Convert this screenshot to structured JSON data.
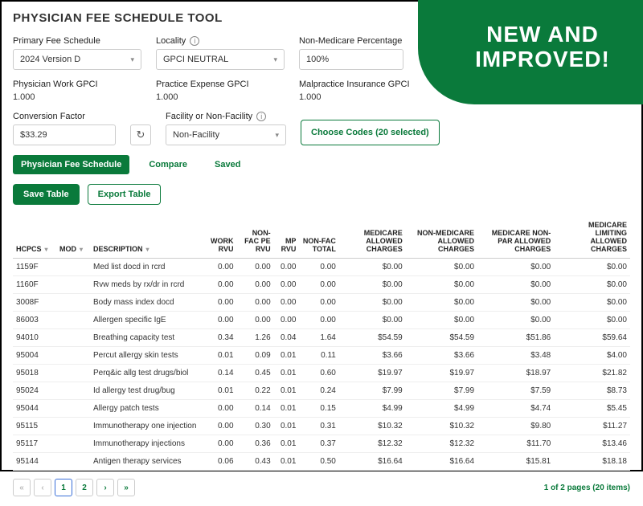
{
  "ribbon": {
    "line1": "NEW AND",
    "line2": "IMPROVED!"
  },
  "title": "PHYSICIAN FEE SCHEDULE TOOL",
  "filters": {
    "primary_label": "Primary Fee Schedule",
    "primary_value": "2024 Version D",
    "locality_label": "Locality",
    "locality_value": "GPCI NEUTRAL",
    "nonmed_label": "Non-Medicare Percentage",
    "nonmed_value": "100%"
  },
  "gpci": {
    "work_label": "Physician Work GPCI",
    "work_value": "1.000",
    "pe_label": "Practice Expense GPCI",
    "pe_value": "1.000",
    "mp_label": "Malpractice Insurance GPCI",
    "mp_value": "1.000"
  },
  "conv": {
    "label": "Conversion Factor",
    "value": "$33.29",
    "facility_label": "Facility or Non-Facility",
    "facility_value": "Non-Facility",
    "choose_codes": "Choose Codes (20 selected)"
  },
  "tabs": {
    "fee": "Physician Fee Schedule",
    "compare": "Compare",
    "saved": "Saved"
  },
  "buttons": {
    "save": "Save Table",
    "export": "Export Table"
  },
  "columns": {
    "hcpcs": "HCPCS",
    "mod": "MOD",
    "desc": "DESCRIPTION",
    "work": "WORK RVU",
    "nfpe": "NON-FAC PE RVU",
    "mp": "MP RVU",
    "nftot": "NON-FAC TOTAL",
    "med": "MEDICARE ALLOWED CHARGES",
    "nonmed": "NON-MEDICARE ALLOWED CHARGES",
    "nonpar": "MEDICARE NON-PAR ALLOWED CHARGES",
    "limit": "MEDICARE LIMITING ALLOWED CHARGES"
  },
  "rows": [
    {
      "hcpcs": "1159F",
      "mod": "",
      "desc": "Med list docd in rcrd",
      "work": "0.00",
      "nfpe": "0.00",
      "mp": "0.00",
      "nftot": "0.00",
      "med": "$0.00",
      "nonmed": "$0.00",
      "nonpar": "$0.00",
      "limit": "$0.00"
    },
    {
      "hcpcs": "1160F",
      "mod": "",
      "desc": "Rvw meds by rx/dr in rcrd",
      "work": "0.00",
      "nfpe": "0.00",
      "mp": "0.00",
      "nftot": "0.00",
      "med": "$0.00",
      "nonmed": "$0.00",
      "nonpar": "$0.00",
      "limit": "$0.00"
    },
    {
      "hcpcs": "3008F",
      "mod": "",
      "desc": "Body mass index docd",
      "work": "0.00",
      "nfpe": "0.00",
      "mp": "0.00",
      "nftot": "0.00",
      "med": "$0.00",
      "nonmed": "$0.00",
      "nonpar": "$0.00",
      "limit": "$0.00"
    },
    {
      "hcpcs": "86003",
      "mod": "",
      "desc": "Allergen specific IgE",
      "work": "0.00",
      "nfpe": "0.00",
      "mp": "0.00",
      "nftot": "0.00",
      "med": "$0.00",
      "nonmed": "$0.00",
      "nonpar": "$0.00",
      "limit": "$0.00"
    },
    {
      "hcpcs": "94010",
      "mod": "",
      "desc": "Breathing capacity test",
      "work": "0.34",
      "nfpe": "1.26",
      "mp": "0.04",
      "nftot": "1.64",
      "med": "$54.59",
      "nonmed": "$54.59",
      "nonpar": "$51.86",
      "limit": "$59.64"
    },
    {
      "hcpcs": "95004",
      "mod": "",
      "desc": "Percut allergy skin tests",
      "work": "0.01",
      "nfpe": "0.09",
      "mp": "0.01",
      "nftot": "0.11",
      "med": "$3.66",
      "nonmed": "$3.66",
      "nonpar": "$3.48",
      "limit": "$4.00"
    },
    {
      "hcpcs": "95018",
      "mod": "",
      "desc": "Perq&ic allg test drugs/biol",
      "work": "0.14",
      "nfpe": "0.45",
      "mp": "0.01",
      "nftot": "0.60",
      "med": "$19.97",
      "nonmed": "$19.97",
      "nonpar": "$18.97",
      "limit": "$21.82"
    },
    {
      "hcpcs": "95024",
      "mod": "",
      "desc": "Id allergy test drug/bug",
      "work": "0.01",
      "nfpe": "0.22",
      "mp": "0.01",
      "nftot": "0.24",
      "med": "$7.99",
      "nonmed": "$7.99",
      "nonpar": "$7.59",
      "limit": "$8.73"
    },
    {
      "hcpcs": "95044",
      "mod": "",
      "desc": "Allergy patch tests",
      "work": "0.00",
      "nfpe": "0.14",
      "mp": "0.01",
      "nftot": "0.15",
      "med": "$4.99",
      "nonmed": "$4.99",
      "nonpar": "$4.74",
      "limit": "$5.45"
    },
    {
      "hcpcs": "95115",
      "mod": "",
      "desc": "Immunotherapy one injection",
      "work": "0.00",
      "nfpe": "0.30",
      "mp": "0.01",
      "nftot": "0.31",
      "med": "$10.32",
      "nonmed": "$10.32",
      "nonpar": "$9.80",
      "limit": "$11.27"
    },
    {
      "hcpcs": "95117",
      "mod": "",
      "desc": "Immunotherapy injections",
      "work": "0.00",
      "nfpe": "0.36",
      "mp": "0.01",
      "nftot": "0.37",
      "med": "$12.32",
      "nonmed": "$12.32",
      "nonpar": "$11.70",
      "limit": "$13.46"
    },
    {
      "hcpcs": "95144",
      "mod": "",
      "desc": "Antigen therapy services",
      "work": "0.06",
      "nfpe": "0.43",
      "mp": "0.01",
      "nftot": "0.50",
      "med": "$16.64",
      "nonmed": "$16.64",
      "nonpar": "$15.81",
      "limit": "$18.18"
    }
  ],
  "pager": {
    "pages": [
      "1",
      "2"
    ],
    "info": "1 of 2 pages (20 items)"
  }
}
